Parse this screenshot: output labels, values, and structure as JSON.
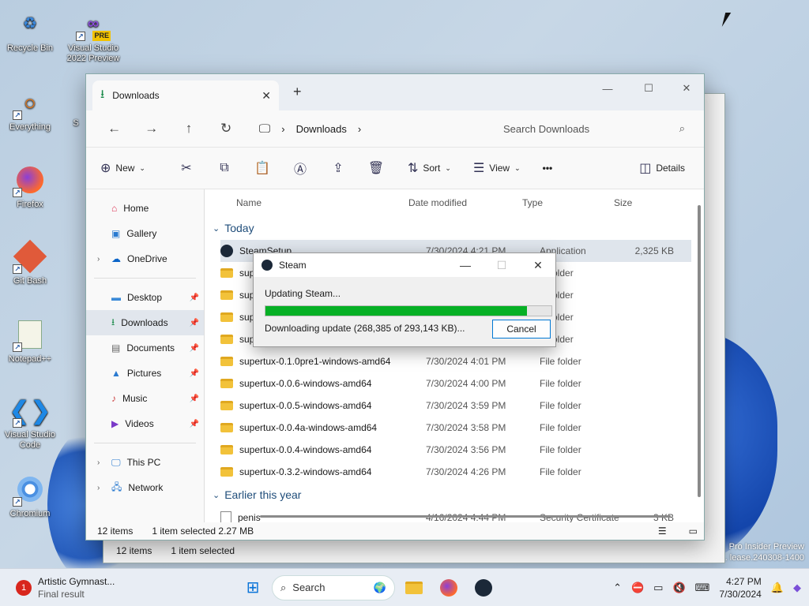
{
  "desktop": {
    "icons": [
      {
        "label": "Recycle Bin",
        "icon": "recycle-bin-icon"
      },
      {
        "label": "Visual Studio 2022 Preview",
        "icon": "visual-studio-icon",
        "badge": "PRE"
      },
      {
        "label": "Everything",
        "icon": "everything-search-icon"
      },
      {
        "label": "Firefox",
        "icon": "firefox-icon"
      },
      {
        "label": "Git Bash",
        "icon": "git-bash-icon"
      },
      {
        "label": "Notepad++",
        "icon": "notepad-plus-plus-icon"
      },
      {
        "label": "Visual Studio Code",
        "icon": "vscode-icon"
      },
      {
        "label": "Chromium",
        "icon": "chromium-icon"
      }
    ],
    "partial_icon_letter": "S",
    "watermark": {
      "line1": "Pro Insider Preview",
      "line2": "Evaluation copy. ... lease.240308-1400"
    }
  },
  "bg_window": {
    "status_items": "12 items",
    "status_selected": "1 item selected"
  },
  "explorer": {
    "tab_title": "Downloads",
    "address": {
      "segment": "Downloads"
    },
    "search_placeholder": "Search Downloads",
    "toolbar": {
      "new": "New",
      "sort": "Sort",
      "view": "View",
      "more": "•••",
      "details": "Details"
    },
    "sidebar": {
      "top": [
        {
          "label": "Home",
          "icon": "home-icon"
        },
        {
          "label": "Gallery",
          "icon": "gallery-icon"
        },
        {
          "label": "OneDrive",
          "icon": "onedrive-icon",
          "chevron": true
        }
      ],
      "quick": [
        {
          "label": "Desktop",
          "icon": "desktop-icon",
          "pin": true
        },
        {
          "label": "Downloads",
          "icon": "downloads-icon",
          "pin": true,
          "selected": true
        },
        {
          "label": "Documents",
          "icon": "documents-icon",
          "pin": true
        },
        {
          "label": "Pictures",
          "icon": "pictures-icon",
          "pin": true
        },
        {
          "label": "Music",
          "icon": "music-icon",
          "pin": true
        },
        {
          "label": "Videos",
          "icon": "videos-icon",
          "pin": true
        }
      ],
      "bottom": [
        {
          "label": "This PC",
          "icon": "this-pc-icon",
          "chevron": true
        },
        {
          "label": "Network",
          "icon": "network-icon",
          "chevron": true
        }
      ]
    },
    "columns": [
      "Name",
      "Date modified",
      "Type",
      "Size"
    ],
    "group_today": "Today",
    "group_earlier": "Earlier this year",
    "files_today": [
      {
        "name": "SteamSetup",
        "date": "7/30/2024 4:21 PM",
        "type": "Application",
        "size": "2,325 KB",
        "kind": "steam",
        "selected": true
      },
      {
        "name": "sup",
        "date": "",
        "type": "le folder",
        "size": "",
        "kind": "folder"
      },
      {
        "name": "sup",
        "date": "",
        "type": "le folder",
        "size": "",
        "kind": "folder"
      },
      {
        "name": "sup",
        "date": "",
        "type": "le folder",
        "size": "",
        "kind": "folder"
      },
      {
        "name": "sup",
        "date": "",
        "type": "le folder",
        "size": "",
        "kind": "folder"
      },
      {
        "name": "supertux-0.1.0pre1-windows-amd64",
        "date": "7/30/2024 4:01 PM",
        "type": "File folder",
        "size": "",
        "kind": "folder"
      },
      {
        "name": "supertux-0.0.6-windows-amd64",
        "date": "7/30/2024 4:00 PM",
        "type": "File folder",
        "size": "",
        "kind": "folder"
      },
      {
        "name": "supertux-0.0.5-windows-amd64",
        "date": "7/30/2024 3:59 PM",
        "type": "File folder",
        "size": "",
        "kind": "folder"
      },
      {
        "name": "supertux-0.0.4a-windows-amd64",
        "date": "7/30/2024 3:58 PM",
        "type": "File folder",
        "size": "",
        "kind": "folder"
      },
      {
        "name": "supertux-0.0.4-windows-amd64",
        "date": "7/30/2024 3:56 PM",
        "type": "File folder",
        "size": "",
        "kind": "folder"
      },
      {
        "name": "supertux-0.3.2-windows-amd64",
        "date": "7/30/2024 4:26 PM",
        "type": "File folder",
        "size": "",
        "kind": "folder"
      }
    ],
    "files_earlier": [
      {
        "name": "penis",
        "date": "4/16/2024 4:44 PM",
        "type": "Security Certificate",
        "size": "3 KB",
        "kind": "cert"
      }
    ],
    "status": {
      "items": "12 items",
      "selected": "1 item selected 2.27 MB"
    }
  },
  "steam_dialog": {
    "title": "Steam",
    "status": "Updating Steam...",
    "progress": 0.9156,
    "detail": "Downloading update (268,385 of 293,143 KB)...",
    "cancel": "Cancel",
    "bar_color": "#06b025"
  },
  "taskbar": {
    "weather_title": "Artistic Gymnast...",
    "weather_sub": "Final result",
    "badge": "1",
    "search_label": "Search",
    "time": "4:27 PM",
    "date": "7/30/2024"
  }
}
